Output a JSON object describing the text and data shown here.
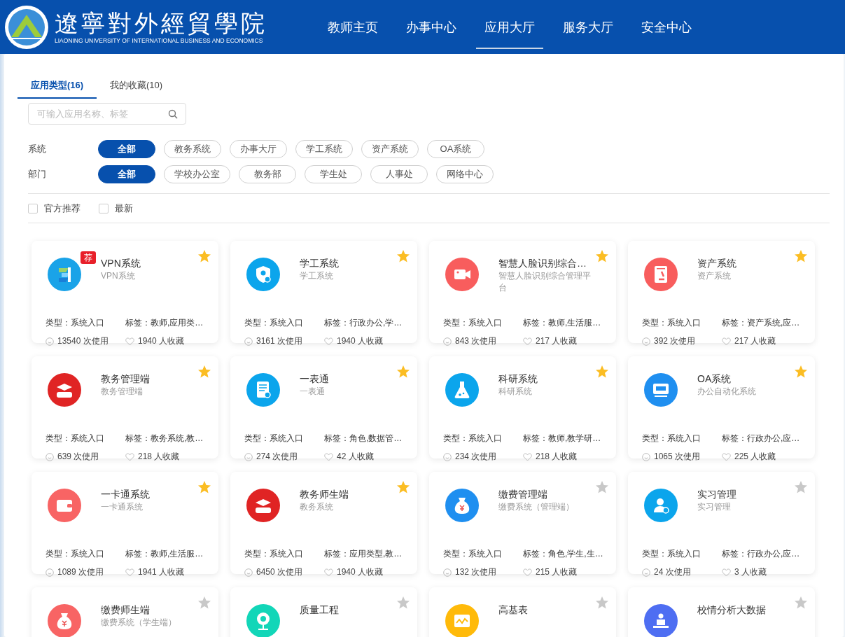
{
  "header": {
    "school_name": "遼寧對外經貿學院",
    "school_name_en": "LIAONING UNIVERSITY OF INTERNATIONAL BUSINESS AND ECONOMICS",
    "nav": [
      {
        "label": "教师主页",
        "selected": false
      },
      {
        "label": "办事中心",
        "selected": false
      },
      {
        "label": "应用大厅",
        "selected": true
      },
      {
        "label": "服务大厅",
        "selected": false
      },
      {
        "label": "安全中心",
        "selected": false
      }
    ]
  },
  "tabs": [
    {
      "label": "应用类型(16)",
      "selected": true
    },
    {
      "label": "我的收藏(10)",
      "selected": false
    }
  ],
  "search": {
    "placeholder": "可输入应用名称、标签"
  },
  "filters": [
    {
      "label": "系统",
      "options": [
        {
          "label": "全部",
          "selected": true
        },
        {
          "label": "教务系统",
          "selected": false
        },
        {
          "label": "办事大厅",
          "selected": false
        },
        {
          "label": "学工系统",
          "selected": false
        },
        {
          "label": "资产系统",
          "selected": false
        },
        {
          "label": "OA系统",
          "selected": false
        }
      ]
    },
    {
      "label": "部门",
      "options": [
        {
          "label": "全部",
          "selected": true
        },
        {
          "label": "学校办公室",
          "selected": false
        },
        {
          "label": "教务部",
          "selected": false
        },
        {
          "label": "学生处",
          "selected": false
        },
        {
          "label": "人事处",
          "selected": false
        },
        {
          "label": "网络中心",
          "selected": false
        }
      ]
    }
  ],
  "checkboxes": [
    {
      "label": "官方推荐",
      "checked": false
    },
    {
      "label": "最新",
      "checked": false
    }
  ],
  "apps": [
    {
      "title": "VPN系统",
      "subtitle": "VPN系统",
      "kind": "vpn",
      "color": "#1aa3e8",
      "badge": "荐",
      "favorited": true,
      "type": "类型：系统入口",
      "tags": "标签：教师,应用类…",
      "uses": "13540 次使用",
      "favorites": "1940 人收藏"
    },
    {
      "title": "学工系统",
      "subtitle": "学工系统",
      "kind": "shield",
      "color": "#0ba5ec",
      "favorited": true,
      "type": "类型：系统入口",
      "tags": "标签：行政办公,学…",
      "uses": "3161 次使用",
      "favorites": "1940 人收藏"
    },
    {
      "title": "智慧人脸识别综合…",
      "subtitle": "智慧人脸识别综合管理平台",
      "kind": "camera",
      "color": "#f85d5d",
      "favorited": true,
      "type": "类型：系统入口",
      "tags": "标签：教师,生活服…",
      "uses": "843 次使用",
      "favorites": "217 人收藏"
    },
    {
      "title": "资产系统",
      "subtitle": "资产系统",
      "kind": "microscope",
      "color": "#f85d5d",
      "favorited": true,
      "type": "类型：系统入口",
      "tags": "标签：资产系统,应…",
      "uses": "392 次使用",
      "favorites": "217 人收藏"
    },
    {
      "title": "教务管理端",
      "subtitle": "教务管理端",
      "kind": "cap",
      "color": "#e02424",
      "favorited": true,
      "type": "类型：系统入口",
      "tags": "标签：教务系统,教…",
      "uses": "639 次使用",
      "favorites": "218 人收藏"
    },
    {
      "title": "一表通",
      "subtitle": "一表通",
      "kind": "form",
      "color": "#0ba5ec",
      "favorited": true,
      "type": "类型：系统入口",
      "tags": "标签：角色,数据管…",
      "uses": "274 次使用",
      "favorites": "42 人收藏"
    },
    {
      "title": "科研系统",
      "subtitle": "科研系统",
      "kind": "flask",
      "color": "#0ba5ec",
      "favorited": true,
      "type": "类型：系统入口",
      "tags": "标签：教师,教学研…",
      "uses": "234 次使用",
      "favorites": "218 人收藏"
    },
    {
      "title": "OA系统",
      "subtitle": "办公自动化系统",
      "kind": "monitor",
      "color": "#1f8ff0",
      "favorited": true,
      "type": "类型：系统入口",
      "tags": "标签：行政办公,应…",
      "uses": "1065 次使用",
      "favorites": "225 人收藏"
    },
    {
      "title": "一卡通系统",
      "subtitle": "一卡通系统",
      "kind": "wallet",
      "color": "#f86464",
      "favorited": true,
      "type": "类型：系统入口",
      "tags": "标签：教师,生活服…",
      "uses": "1089 次使用",
      "favorites": "1941 人收藏"
    },
    {
      "title": "教务师生端",
      "subtitle": "教务系统",
      "kind": "cap",
      "color": "#e02424",
      "favorited": true,
      "type": "类型：系统入口",
      "tags": "标签：应用类型,教…",
      "uses": "6450 次使用",
      "favorites": "1940 人收藏"
    },
    {
      "title": "缴费管理端",
      "subtitle": "缴费系统（管理端）",
      "kind": "moneybag",
      "color": "#1f8ff0",
      "favorited": false,
      "type": "类型：系统入口",
      "tags": "标签：角色,学生,生…",
      "uses": "132 次使用",
      "favorites": "215 人收藏"
    },
    {
      "title": "实习管理",
      "subtitle": "实习管理",
      "kind": "person",
      "color": "#0ba5ec",
      "favorited": false,
      "type": "类型：系统入口",
      "tags": "标签：行政办公,应…",
      "uses": "24 次使用",
      "favorites": "3 人收藏"
    },
    {
      "title": "缴费师生端",
      "subtitle": "缴费系统（学生端）",
      "kind": "moneybag",
      "color": "#f86464",
      "favorited": false
    },
    {
      "title": "质量工程",
      "kind": "globe",
      "color": "#12d6b8",
      "favorited": false
    },
    {
      "title": "高基表",
      "kind": "chart",
      "color": "#ffba0a",
      "favorited": false
    },
    {
      "title": "校情分析大数据",
      "kind": "desk",
      "color": "#4e6ef2",
      "favorited": false
    }
  ]
}
